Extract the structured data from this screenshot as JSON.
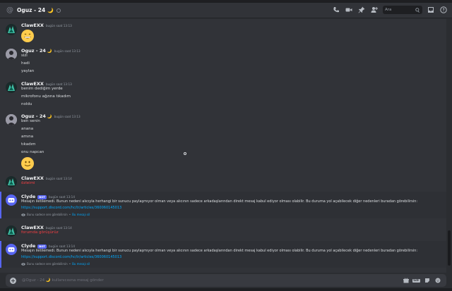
{
  "channel": {
    "title": "Oguz - 24",
    "moon": "🌙",
    "search_placeholder": "Ara"
  },
  "messages": [
    {
      "author": "ClawEXX",
      "time": "bugün saat 13:13",
      "lines": []
    },
    {
      "author": "Oguz - 24",
      "moon": "🌙",
      "time": "bugün saat 13:13",
      "lines": [
        "sizi",
        "hadi",
        "yaylan"
      ]
    },
    {
      "author": "ClawEXX",
      "time": "bugün saat 13:13",
      "lines": [
        "benim dediğim yerde",
        "mikrofonu ağzına tıkadım",
        "noldu"
      ]
    },
    {
      "author": "Oguz - 24",
      "moon": "🌙",
      "time": "bugün saat 13:13",
      "lines": [
        "ben senin",
        "anana",
        "amına",
        "tıkadım",
        "onu napcan"
      ]
    },
    {
      "author": "ClawEXX",
      "time": "bugün saat 13:14",
      "lines": [
        "özleimi"
      ]
    },
    {
      "author": "Clyde",
      "bot": "BOT",
      "time": "bugün saat 13:14",
      "text": "Mesajın iletilemedi. Bunun nedeni alıcıyla herhangi bir sunucu paylaşmıyor olman veya alıcının sadece arkadaşlarından direkt mesaj kabul ediyor olması olabilir. Bu duruma yol açabilecek diğer nedenleri buradan görebilirsin:",
      "link": "https://support.discord.com/hc/tr/articles/360060145013",
      "note": "Bunu sadece sen görebilirsin",
      "note_link": "Bu mesajı sil"
    },
    {
      "author": "ClawEXX",
      "time": "bugün saat 13:14",
      "lines": [
        "forumda görüşürüz"
      ]
    },
    {
      "author": "Clyde",
      "bot": "BOT",
      "time": "bugün saat 13:14",
      "text": "Mesajın iletilemedi. Bunun nedeni alıcıyla herhangi bir sunucu paylaşmıyor olman veya alıcının sadece arkadaşlarından direkt mesaj kabul ediyor olması olabilir. Bu duruma yol açabilecek diğer nedenleri buradan görebilirsin:",
      "link": "https://support.discord.com/hc/tr/articles/360060145013",
      "note": "Bunu sadece sen görebilirsin",
      "note_link": "Bu mesajı sil"
    }
  ],
  "composer": {
    "placeholder": "@Oguz - 24 🌙 kullanıcısına mesaj gönder",
    "gif_label": "GIF"
  },
  "colors": {
    "accent": "#5865f2",
    "error_text": "#f23f43",
    "link": "#00a8fc",
    "moon": "#f0b232"
  }
}
